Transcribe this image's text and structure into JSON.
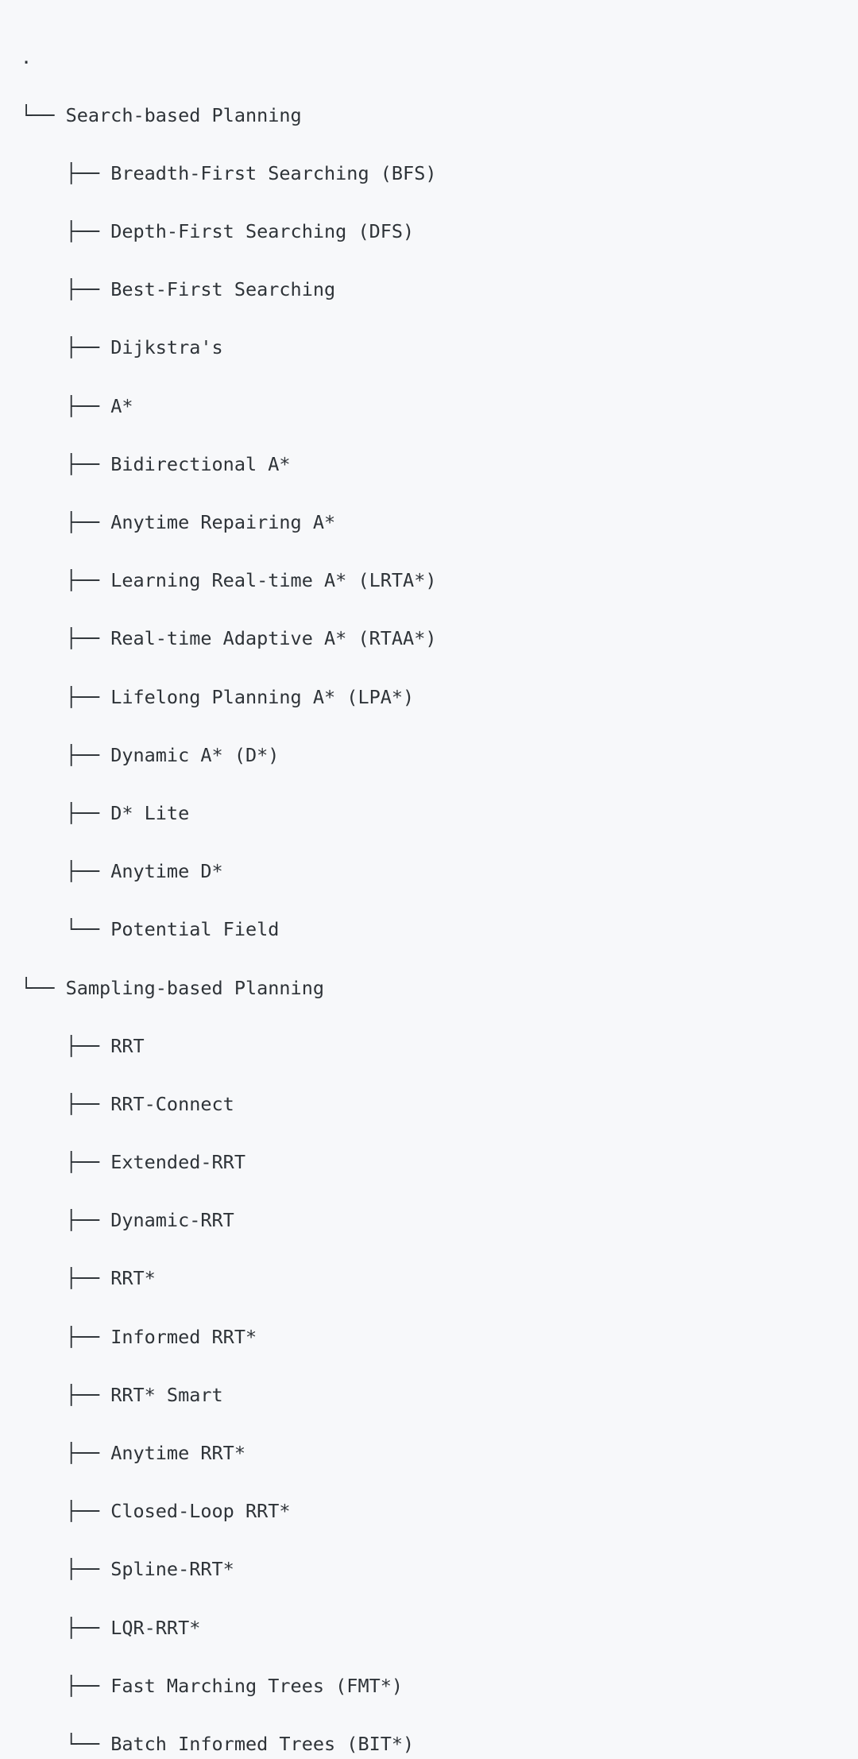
{
  "page": {
    "title": "PathPlanning algorithm tree",
    "background_color": "#f7f8fa",
    "text_color": "#2e3338",
    "font_size_px": 23.5,
    "line_height_px": 36.6
  },
  "tree": {
    "root_label": ".",
    "branch_tee": "├── ",
    "branch_end": "└── ",
    "pipe_indent": "│   ",
    "blank_indent": "    ",
    "lines": [
      {
        "prefix": "",
        "label": ".",
        "depth": 0,
        "kind": "root"
      },
      {
        "prefix": "└── ",
        "label": "Search-based Planning",
        "depth": 1,
        "kind": "end"
      },
      {
        "prefix": "    ├── ",
        "label": "Breadth-First Searching (BFS)",
        "depth": 2,
        "kind": "tee"
      },
      {
        "prefix": "    ├── ",
        "label": "Depth-First Searching (DFS)",
        "depth": 2,
        "kind": "tee"
      },
      {
        "prefix": "    ├── ",
        "label": "Best-First Searching",
        "depth": 2,
        "kind": "tee"
      },
      {
        "prefix": "    ├── ",
        "label": "Dijkstra's",
        "depth": 2,
        "kind": "tee"
      },
      {
        "prefix": "    ├── ",
        "label": "A*",
        "depth": 2,
        "kind": "tee"
      },
      {
        "prefix": "    ├── ",
        "label": "Bidirectional A*",
        "depth": 2,
        "kind": "tee"
      },
      {
        "prefix": "    ├── ",
        "label": "Anytime Repairing A*",
        "depth": 2,
        "kind": "tee"
      },
      {
        "prefix": "    ├── ",
        "label": "Learning Real-time A* (LRTA*)",
        "depth": 2,
        "kind": "tee"
      },
      {
        "prefix": "    ├── ",
        "label": "Real-time Adaptive A* (RTAA*)",
        "depth": 2,
        "kind": "tee"
      },
      {
        "prefix": "    ├── ",
        "label": "Lifelong Planning A* (LPA*)",
        "depth": 2,
        "kind": "tee"
      },
      {
        "prefix": "    ├── ",
        "label": "Dynamic A* (D*)",
        "depth": 2,
        "kind": "tee"
      },
      {
        "prefix": "    ├── ",
        "label": "D* Lite",
        "depth": 2,
        "kind": "tee"
      },
      {
        "prefix": "    ├── ",
        "label": "Anytime D*",
        "depth": 2,
        "kind": "tee"
      },
      {
        "prefix": "    └── ",
        "label": "Potential Field",
        "depth": 2,
        "kind": "end"
      },
      {
        "prefix": "└── ",
        "label": "Sampling-based Planning",
        "depth": 1,
        "kind": "end"
      },
      {
        "prefix": "    ├── ",
        "label": "RRT",
        "depth": 2,
        "kind": "tee"
      },
      {
        "prefix": "    ├── ",
        "label": "RRT-Connect",
        "depth": 2,
        "kind": "tee"
      },
      {
        "prefix": "    ├── ",
        "label": "Extended-RRT",
        "depth": 2,
        "kind": "tee"
      },
      {
        "prefix": "    ├── ",
        "label": "Dynamic-RRT",
        "depth": 2,
        "kind": "tee"
      },
      {
        "prefix": "    ├── ",
        "label": "RRT*",
        "depth": 2,
        "kind": "tee"
      },
      {
        "prefix": "    ├── ",
        "label": "Informed RRT*",
        "depth": 2,
        "kind": "tee"
      },
      {
        "prefix": "    ├── ",
        "label": "RRT* Smart",
        "depth": 2,
        "kind": "tee"
      },
      {
        "prefix": "    ├── ",
        "label": "Anytime RRT*",
        "depth": 2,
        "kind": "tee"
      },
      {
        "prefix": "    ├── ",
        "label": "Closed-Loop RRT*",
        "depth": 2,
        "kind": "tee"
      },
      {
        "prefix": "    ├── ",
        "label": "Spline-RRT*",
        "depth": 2,
        "kind": "tee"
      },
      {
        "prefix": "    ├── ",
        "label": "LQR-RRT*",
        "depth": 2,
        "kind": "tee"
      },
      {
        "prefix": "    ├── ",
        "label": "Fast Marching Trees (FMT*)",
        "depth": 2,
        "kind": "tee"
      },
      {
        "prefix": "    └── ",
        "label": "Batch Informed Trees (BIT*)",
        "depth": 2,
        "kind": "end"
      }
    ]
  }
}
